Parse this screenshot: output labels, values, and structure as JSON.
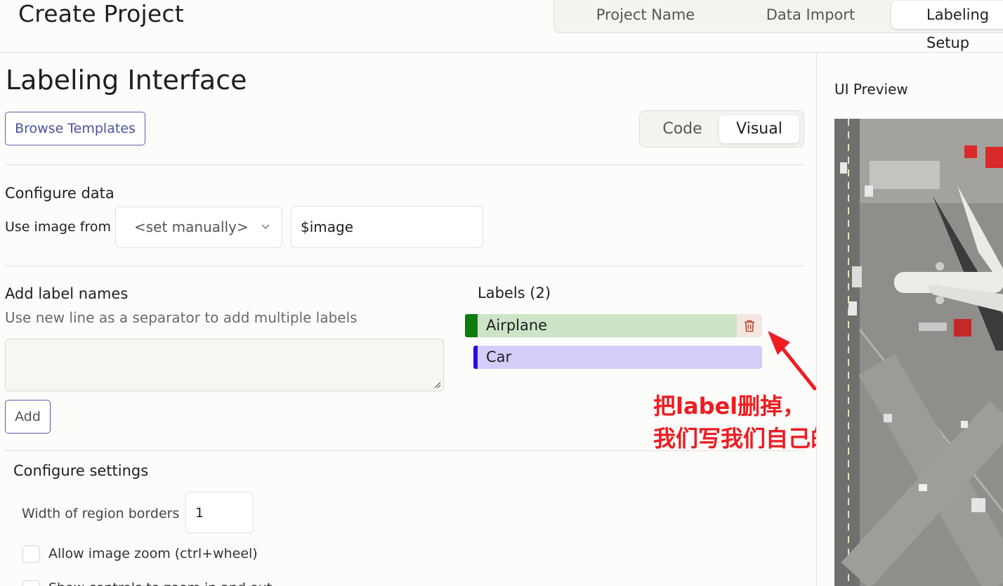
{
  "header": {
    "title": "Create Project",
    "steps": [
      {
        "label": "Project Name",
        "active": false
      },
      {
        "label": "Data Import",
        "active": false
      },
      {
        "label": "Labeling Setup",
        "active": true
      }
    ]
  },
  "labeling": {
    "title": "Labeling Interface",
    "browse_templates_label": "Browse Templates",
    "mode_toggle": {
      "code_label": "Code",
      "visual_label": "Visual",
      "selected": "Visual"
    }
  },
  "configure_data": {
    "title": "Configure data",
    "source_label": "Use image from",
    "source_select_value": "<set manually>",
    "source_input_value": "$image"
  },
  "label_names": {
    "title": "Add label names",
    "hint": "Use new line as a separator to add multiple labels",
    "textarea_value": "",
    "add_label": "Add"
  },
  "labels": {
    "title": "Labels (2)",
    "items": [
      {
        "name": "Airplane",
        "color": "#0e7a0e",
        "background": "#cde4c6"
      },
      {
        "name": "Car",
        "color": "#2a0bd8",
        "background": "#d3cdf9"
      }
    ]
  },
  "annotation": {
    "line1": "把label删掉，",
    "line2": "我们写我们自己的",
    "color": "#ef1c22"
  },
  "settings": {
    "title": "Configure settings",
    "region_border_label": "Width of region borders",
    "region_border_value": "1",
    "zoom_label": "Allow image zoom (ctrl+wheel)",
    "zoom_checked": false,
    "controls_label": "Show controls to zoom in and out",
    "controls_checked": false
  },
  "preview": {
    "title": "UI Preview"
  }
}
